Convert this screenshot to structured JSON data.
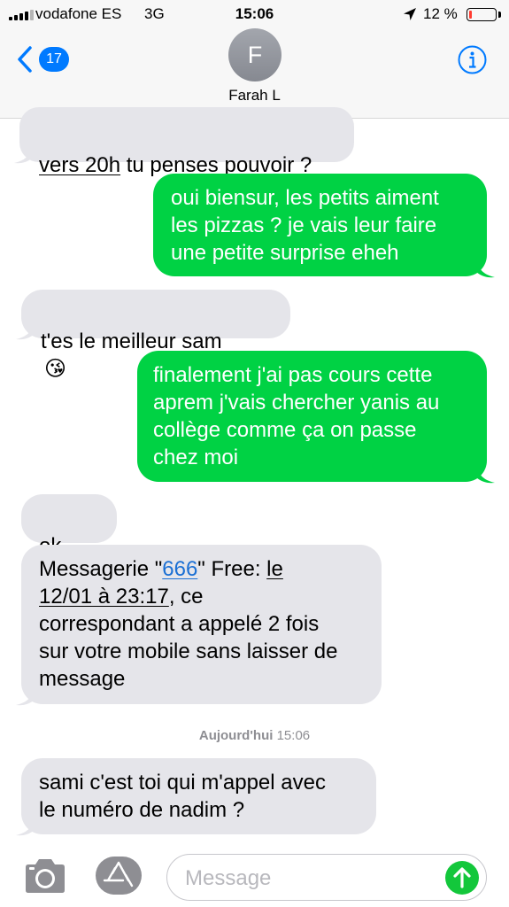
{
  "status_bar": {
    "carrier": "vodafone ES",
    "network": "3G",
    "time": "15:06",
    "battery_percent": "12 %",
    "battery_level": 0.12,
    "location_icon": "location-arrow-icon",
    "battery_color": "#ff3b30"
  },
  "header": {
    "back_badge": "17",
    "back_icon": "chevron-left-icon",
    "avatar_initial": "F",
    "contact_name": "Farah L",
    "info_icon": "info-icon"
  },
  "messages": [
    {
      "direction": "received",
      "text_a": "vers 20h",
      "text_b": " tu penses pouvoir ?"
    },
    {
      "direction": "sent",
      "text": "oui biensur, les petits aiment\nles pizzas ? je vais leur faire\nune petite surprise eheh"
    },
    {
      "direction": "received",
      "text": "t'es le meilleur sam",
      "emoji": "😘"
    },
    {
      "direction": "sent",
      "text": "finalement j'ai pas cours cette\naprem j'vais chercher yanis au\ncollège comme ça on passe\nchez moi"
    },
    {
      "direction": "received",
      "text": "ok",
      "emoji": "👍"
    },
    {
      "direction": "received",
      "part1": "Messagerie \"",
      "link": "666",
      "part2": "\" Free: ",
      "date_link_a": "le",
      "date_link_b": "12/01 à 23:17",
      "part3": ", ce\ncorrespondant a appelé 2 fois\nsur votre mobile sans laisser de\nmessage"
    },
    {
      "direction": "received",
      "text": "sami c'est toi qui m'appel avec\nle numéro de nadim ?"
    }
  ],
  "timestamp": {
    "day": "Aujourd'hui",
    "time": "15:06"
  },
  "input_bar": {
    "camera_icon": "camera-icon",
    "apps_icon": "app-store-icon",
    "placeholder": "Message",
    "send_icon": "arrow-up-icon"
  },
  "colors": {
    "sent_bubble": "#00d244",
    "received_bubble": "#e5e5ea",
    "accent": "#007aff",
    "send_button": "#13c73b"
  }
}
